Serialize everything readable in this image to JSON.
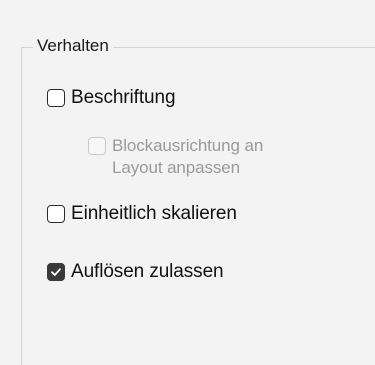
{
  "group": {
    "title": "Verhalten"
  },
  "options": {
    "annotative": {
      "label": "Beschriftung",
      "checked": false,
      "enabled": true
    },
    "match_orientation": {
      "label_line1": "Blockausrichtung an",
      "label_line2": "Layout anpassen",
      "checked": false,
      "enabled": false
    },
    "scale_uniformly": {
      "label": "Einheitlich skalieren",
      "checked": false,
      "enabled": true
    },
    "allow_exploding": {
      "label": "Auflösen zulassen",
      "checked": true,
      "enabled": true
    }
  },
  "colors": {
    "checked_fill": "#3a3a3a",
    "disabled_text": "#9a9a9a",
    "background": "#f3f3f3"
  }
}
